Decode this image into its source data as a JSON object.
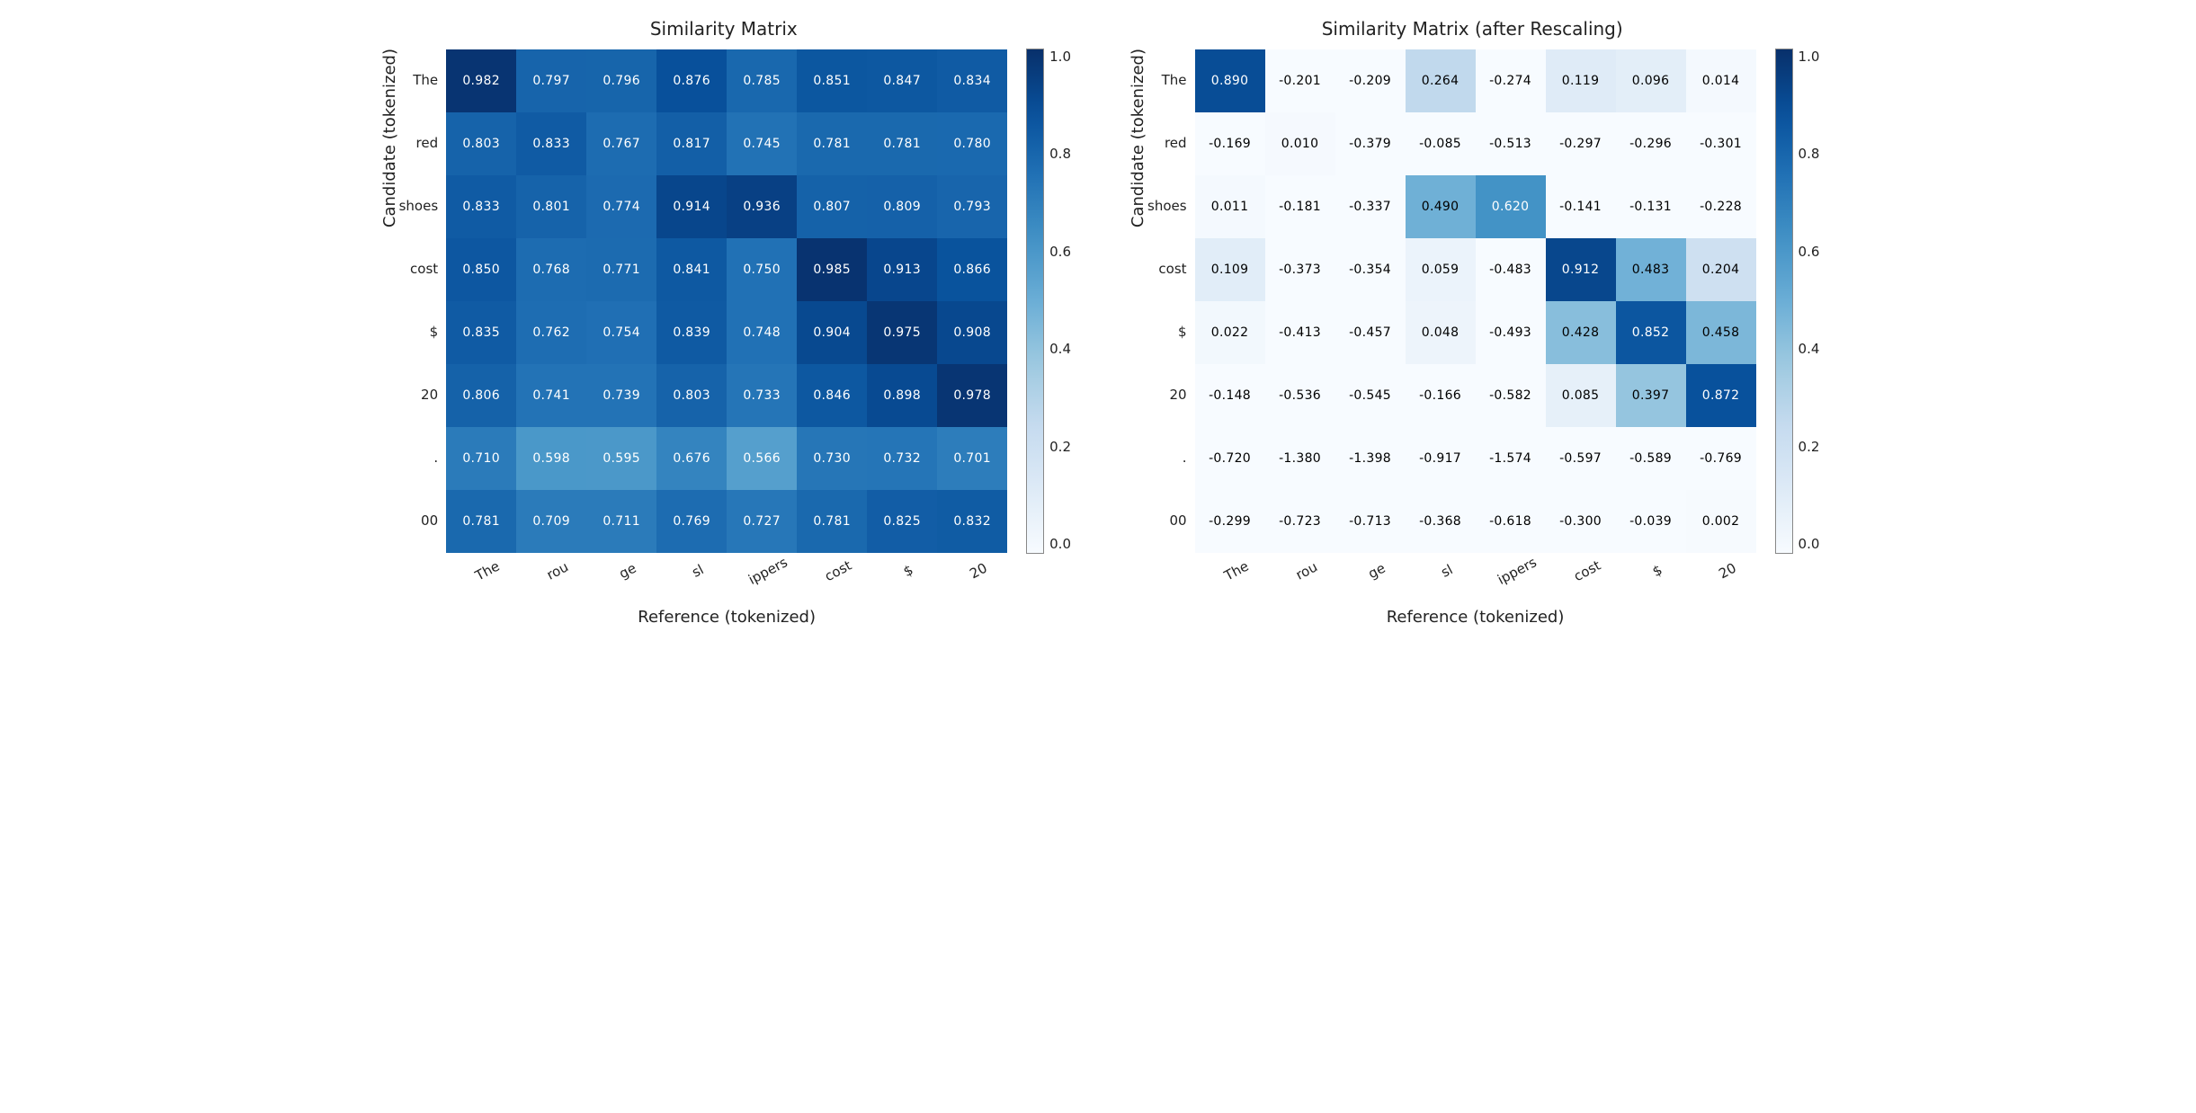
{
  "chart_data": [
    {
      "type": "heatmap",
      "title": "Similarity Matrix",
      "xlabel": "Reference (tokenized)",
      "ylabel": "Candidate (tokenized)",
      "xticks": [
        "The",
        "rou",
        "ge",
        "sl",
        "ippers",
        "cost",
        "$",
        "20"
      ],
      "yticks": [
        "The",
        "red",
        "shoes",
        "cost",
        "$",
        "20",
        ".",
        "00"
      ],
      "vmin": 0.0,
      "vmax": 1.0,
      "cbar_ticks": [
        "1.0",
        "0.8",
        "0.6",
        "0.4",
        "0.2",
        "0.0"
      ],
      "values": [
        [
          0.982,
          0.797,
          0.796,
          0.876,
          0.785,
          0.851,
          0.847,
          0.834
        ],
        [
          0.803,
          0.833,
          0.767,
          0.817,
          0.745,
          0.781,
          0.781,
          0.78
        ],
        [
          0.833,
          0.801,
          0.774,
          0.914,
          0.936,
          0.807,
          0.809,
          0.793
        ],
        [
          0.85,
          0.768,
          0.771,
          0.841,
          0.75,
          0.985,
          0.913,
          0.866
        ],
        [
          0.835,
          0.762,
          0.754,
          0.839,
          0.748,
          0.904,
          0.975,
          0.908
        ],
        [
          0.806,
          0.741,
          0.739,
          0.803,
          0.733,
          0.846,
          0.898,
          0.978
        ],
        [
          0.71,
          0.598,
          0.595,
          0.676,
          0.566,
          0.73,
          0.732,
          0.701
        ],
        [
          0.781,
          0.709,
          0.711,
          0.769,
          0.727,
          0.781,
          0.825,
          0.832
        ]
      ]
    },
    {
      "type": "heatmap",
      "title": "Similarity Matrix (after Rescaling)",
      "xlabel": "Reference (tokenized)",
      "ylabel": "Candidate (tokenized)",
      "xticks": [
        "The",
        "rou",
        "ge",
        "sl",
        "ippers",
        "cost",
        "$",
        "20"
      ],
      "yticks": [
        "The",
        "red",
        "shoes",
        "cost",
        "$",
        "20",
        ".",
        "00"
      ],
      "vmin": 0.0,
      "vmax": 1.0,
      "cbar_ticks": [
        "1.0",
        "0.8",
        "0.6",
        "0.4",
        "0.2",
        "0.0"
      ],
      "values": [
        [
          0.89,
          -0.201,
          -0.209,
          0.264,
          -0.274,
          0.119,
          0.096,
          0.014
        ],
        [
          -0.169,
          0.01,
          -0.379,
          -0.085,
          -0.513,
          -0.297,
          -0.296,
          -0.301
        ],
        [
          0.011,
          -0.181,
          -0.337,
          0.49,
          0.62,
          -0.141,
          -0.131,
          -0.228
        ],
        [
          0.109,
          -0.373,
          -0.354,
          0.059,
          -0.483,
          0.912,
          0.483,
          0.204
        ],
        [
          0.022,
          -0.413,
          -0.457,
          0.048,
          -0.493,
          0.428,
          0.852,
          0.458
        ],
        [
          -0.148,
          -0.536,
          -0.545,
          -0.166,
          -0.582,
          0.085,
          0.397,
          0.872
        ],
        [
          -0.72,
          -1.38,
          -1.398,
          -0.917,
          -1.574,
          -0.597,
          -0.589,
          -0.769
        ],
        [
          -0.299,
          -0.723,
          -0.713,
          -0.368,
          -0.618,
          -0.3,
          -0.039,
          0.002
        ]
      ]
    }
  ]
}
